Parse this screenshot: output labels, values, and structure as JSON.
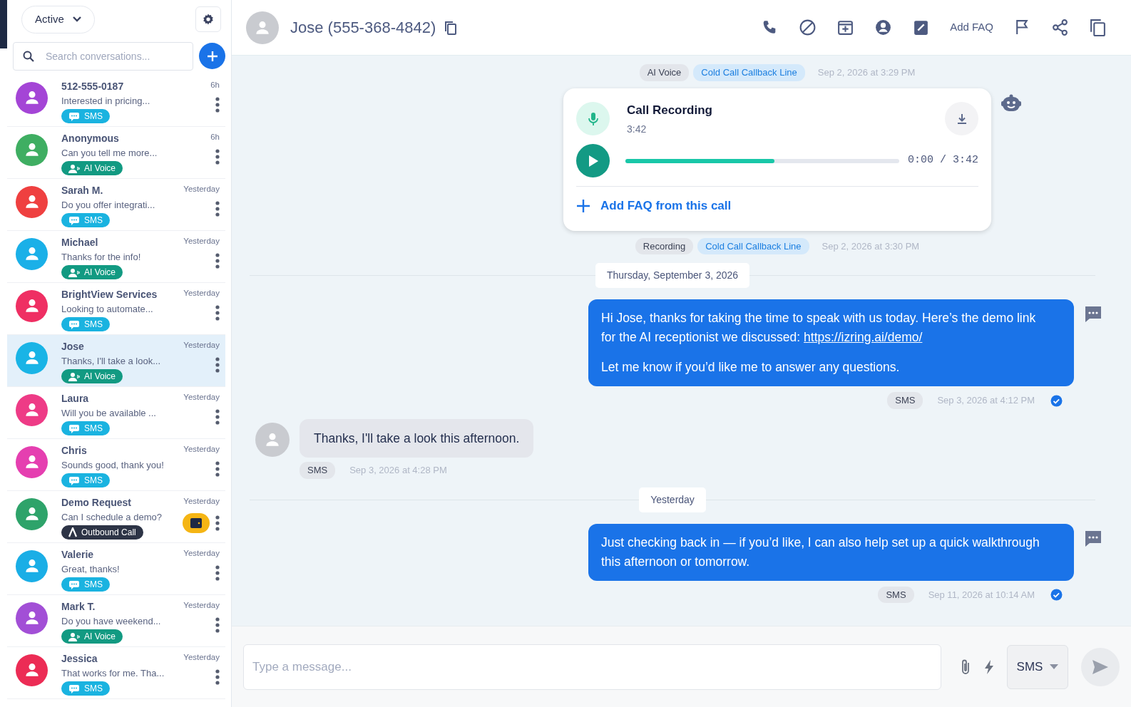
{
  "sidebar": {
    "filter": "Active",
    "search": {
      "placeholder": "Search conversations..."
    },
    "conversations": [
      {
        "name": "512-555-0187",
        "preview": "Interested in pricing...",
        "time": "6h",
        "channel": {
          "kind": "sms",
          "label": "SMS"
        },
        "color": "#a445d6",
        "selected": false,
        "alert": false
      },
      {
        "name": "Anonymous",
        "preview": "Can you tell me more...",
        "time": "6h",
        "channel": {
          "kind": "ai_voice",
          "label": "AI Voice"
        },
        "color": "#3fae62",
        "selected": false,
        "alert": false
      },
      {
        "name": "Sarah M.",
        "preview": "Do you offer integrati...",
        "time": "Yesterday",
        "channel": {
          "kind": "sms",
          "label": "SMS"
        },
        "color": "#ef4040",
        "selected": false,
        "alert": false
      },
      {
        "name": "Michael",
        "preview": "Thanks for the info!",
        "time": "Yesterday",
        "channel": {
          "kind": "ai_voice",
          "label": "AI Voice"
        },
        "color": "#1ab0e8",
        "selected": false,
        "alert": false
      },
      {
        "name": "BrightView Services",
        "preview": "Looking to automate...",
        "time": "Yesterday",
        "channel": {
          "kind": "sms",
          "label": "SMS"
        },
        "color": "#ef2f63",
        "selected": false,
        "alert": false
      },
      {
        "name": "Jose",
        "preview": "Thanks, I'll take a look...",
        "time": "Yesterday",
        "channel": {
          "kind": "ai_voice",
          "label": "AI Voice"
        },
        "color": "#19b4e6",
        "selected": true,
        "alert": false
      },
      {
        "name": "Laura",
        "preview": "Will you be available ...",
        "time": "Yesterday",
        "channel": {
          "kind": "sms",
          "label": "SMS"
        },
        "color": "#ee3b86",
        "selected": false,
        "alert": false
      },
      {
        "name": "Chris",
        "preview": "Sounds good, thank you!",
        "time": "Yesterday",
        "channel": {
          "kind": "sms",
          "label": "SMS"
        },
        "color": "#e53fb0",
        "selected": false,
        "alert": false
      },
      {
        "name": "Demo Request",
        "preview": "Can I schedule a demo?",
        "time": "Yesterday",
        "channel": {
          "kind": "outbound_call",
          "label": "Outbound Call"
        },
        "color": "#2ea36a",
        "selected": false,
        "alert": true
      },
      {
        "name": "Valerie",
        "preview": "Great, thanks!",
        "time": "Yesterday",
        "channel": {
          "kind": "sms",
          "label": "SMS"
        },
        "color": "#1aaee6",
        "selected": false,
        "alert": false
      },
      {
        "name": "Mark T.",
        "preview": "Do you have weekend...",
        "time": "Yesterday",
        "channel": {
          "kind": "ai_voice",
          "label": "AI Voice"
        },
        "color": "#a24fd6",
        "selected": false,
        "alert": false
      },
      {
        "name": "Jessica",
        "preview": "That works for me. Tha...",
        "time": "Yesterday",
        "channel": {
          "kind": "sms",
          "label": "SMS"
        },
        "color": "#ec2c55",
        "selected": false,
        "alert": false
      }
    ]
  },
  "header": {
    "contact": "Jose (555-368-4842)",
    "add_faq": "Add FAQ"
  },
  "timeline": [
    {
      "kind": "meta",
      "tags": [
        {
          "kind": "channel",
          "label": "AI Voice"
        },
        {
          "kind": "line",
          "label": "Cold Call Callback Line"
        }
      ],
      "time": "Sep 2, 2026 at 3:29 PM"
    },
    {
      "kind": "recording",
      "title": "Call Recording",
      "duration": "3:42",
      "level": 0.545,
      "reading": "0:00 / 3:42",
      "action": "Add FAQ from this call"
    },
    {
      "kind": "meta",
      "tags": [
        {
          "kind": "channel",
          "label": "Recording"
        },
        {
          "kind": "line",
          "label": "Cold Call Callback Line"
        }
      ],
      "time": "Sep 2, 2026 at 3:30 PM"
    },
    {
      "kind": "divider",
      "label": "Thursday, September 3, 2026"
    },
    {
      "kind": "outgoing",
      "paragraphs": [
        {
          "text": "Hi Jose, thanks for taking the time to speak with us today. Here’s the demo link for the AI receptionist we discussed: ",
          "link": "https://izring.ai/demo/"
        },
        {
          "text": "Let me know if you’d like me to answer any questions."
        }
      ],
      "tag": "SMS",
      "time": "Sep 3, 2026 at 4:12 PM",
      "delivered": true
    },
    {
      "kind": "incoming",
      "text": "Thanks, I'll take a look this afternoon.",
      "tag": "SMS",
      "time": "Sep 3, 2026 at 4:28 PM"
    },
    {
      "kind": "divider",
      "label": "Yesterday"
    },
    {
      "kind": "outgoing",
      "paragraphs": [
        {
          "text": "Just checking back in — if you’d like, I can also help set up a quick walkthrough this afternoon or tomorrow."
        }
      ],
      "tag": "SMS",
      "time": "Sep 11, 2026 at 10:14 AM",
      "delivered": true
    }
  ],
  "composer": {
    "placeholder": "Type a message...",
    "channel": "SMS"
  }
}
